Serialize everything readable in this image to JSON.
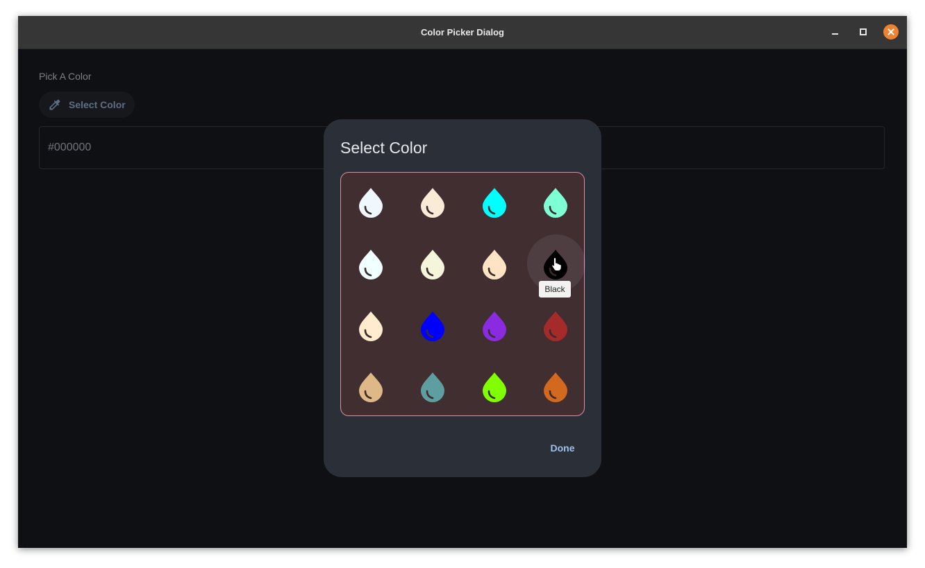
{
  "window": {
    "title": "Color Picker Dialog",
    "controls": [
      "minimize-icon",
      "maximize-icon",
      "close-icon"
    ],
    "close_color": "#f0812f"
  },
  "main": {
    "label": "Pick A Color",
    "select_button": {
      "icon": "eyedropper-icon",
      "label": "Select Color"
    },
    "hex_value": "#000000"
  },
  "dialog": {
    "title": "Select Color",
    "grid_border_color": "#df8fa4",
    "colors": [
      [
        "#f0f8ff",
        "#faebd7",
        "#00ffff",
        "#7fffd4"
      ],
      [
        "#f0ffff",
        "#f5f5dc",
        "#ffe4c4",
        "#000000"
      ],
      [
        "#ffebcd",
        "#0000ff",
        "#8a2be2",
        "#a52a2a"
      ],
      [
        "#deb887",
        "#5f9ea0",
        "#7fff00",
        "#d2691e"
      ]
    ],
    "hovered": {
      "row": 1,
      "col": 3
    },
    "tooltip": "Black",
    "done_label": "Done"
  }
}
